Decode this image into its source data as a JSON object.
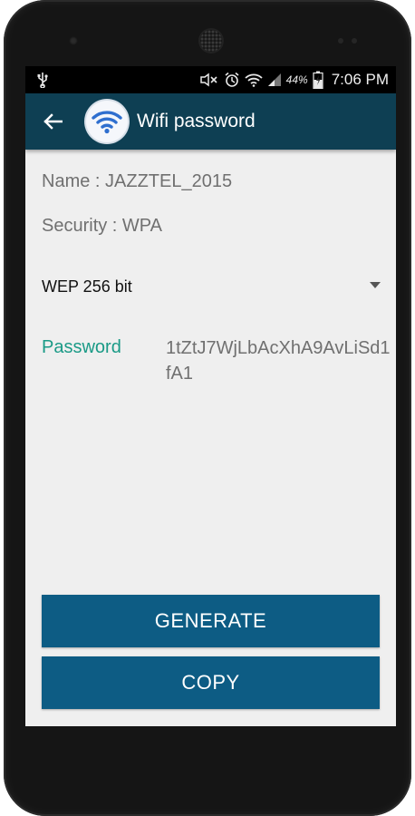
{
  "status_bar": {
    "battery_percent": "44%",
    "time": "7:06 PM"
  },
  "app_bar": {
    "title": "Wifi password"
  },
  "network": {
    "name_line": "Name : JAZZTEL_2015",
    "security_line": "Security : WPA"
  },
  "key_type": {
    "selected": "WEP 256 bit"
  },
  "password": {
    "label": "Password",
    "value": "1tZtJ7WjLbAcXhA9AvLiSd1fA1"
  },
  "buttons": {
    "generate": "GENERATE",
    "copy": "COPY"
  },
  "colors": {
    "app_bar": "#0e3f53",
    "button": "#0d5c84",
    "accent_label": "#1a9a86",
    "screen_bg": "#efefef"
  }
}
